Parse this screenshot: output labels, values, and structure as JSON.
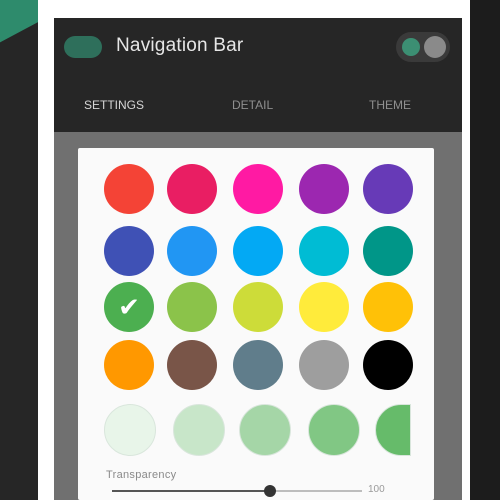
{
  "appbar": {
    "title": "Navigation Bar"
  },
  "tabs": [
    {
      "label": "SETTINGS",
      "active": true
    },
    {
      "label": "DETAIL",
      "active": false
    },
    {
      "label": "THEME",
      "active": false
    }
  ],
  "palette": {
    "colors": [
      "#f44336",
      "#e91e63",
      "#ff1aa3",
      "#9c27b0",
      "#673ab7",
      "#3f51b5",
      "#2196f3",
      "#03a9f4",
      "#00bcd4",
      "#009688",
      "#4caf50",
      "#8bc34a",
      "#cddc39",
      "#ffeb3b",
      "#ffc107",
      "#ff9800",
      "#795548",
      "#607d8b",
      "#9e9e9e",
      "#000000"
    ],
    "selected_index": 10
  },
  "shades": [
    "#e8f5e9",
    "#c8e6c9",
    "#a5d6a7",
    "#81c784",
    "#66bb6a"
  ],
  "transparency": {
    "label": "Transparency",
    "value": 0.63,
    "value_text": "100"
  }
}
